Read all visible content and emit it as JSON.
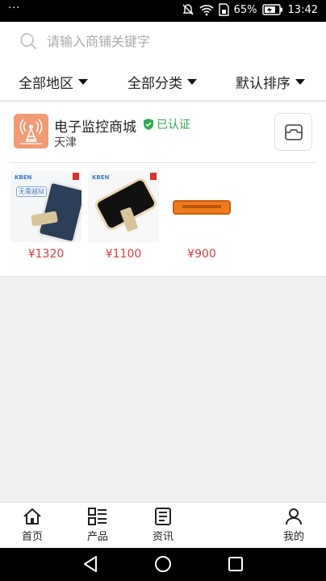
{
  "status_bar": {
    "dots": "···",
    "battery_percent": "65%",
    "time": "13:42",
    "icons": [
      "mute-icon",
      "wifi-icon",
      "sim-icon",
      "battery-icon"
    ]
  },
  "search": {
    "placeholder": "请输入商铺关键字",
    "icon": "search-icon"
  },
  "filters": [
    {
      "label": "全部地区"
    },
    {
      "label": "全部分类"
    },
    {
      "label": "默认排序"
    }
  ],
  "shop": {
    "name": "电子监控商城",
    "verified_label": "已认证",
    "city": "天津",
    "logo_icon": "antenna-icon",
    "message_icon": "message-icon",
    "products": [
      {
        "brand": "KBEN",
        "tag": "无需越狱",
        "price": "¥1320"
      },
      {
        "brand": "KBEN",
        "price": "¥1100"
      },
      {
        "price": "¥900"
      }
    ]
  },
  "bottom_nav": [
    {
      "label": "首页",
      "icon": "home-icon"
    },
    {
      "label": "产品",
      "icon": "grid-list-icon"
    },
    {
      "label": "资讯",
      "icon": "news-icon"
    },
    {
      "label": "我的",
      "icon": "user-icon"
    }
  ],
  "colors": {
    "price": "#e0393e",
    "verified": "#2fa84f",
    "logo_bg": "#f29a73"
  }
}
